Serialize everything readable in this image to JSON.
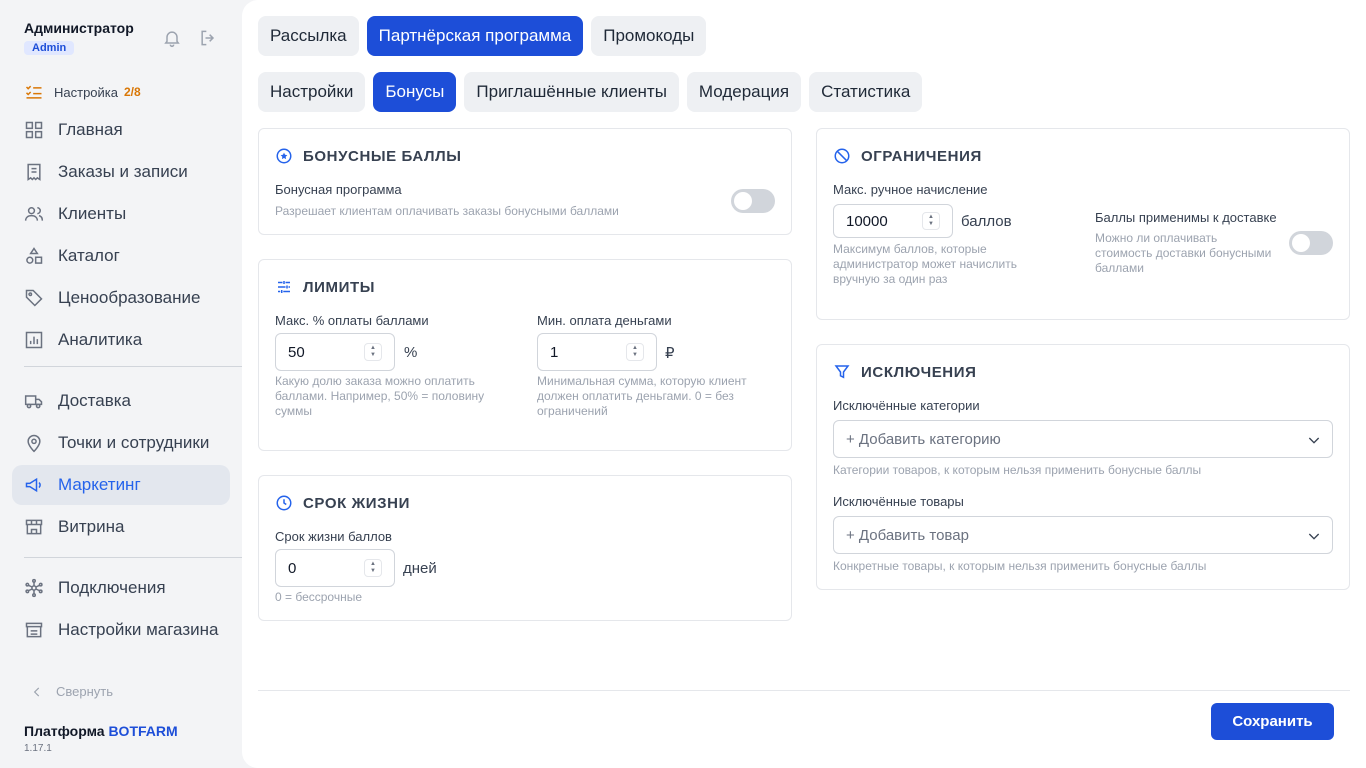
{
  "user": {
    "name": "Администратор",
    "role": "Admin"
  },
  "setup": {
    "label": "Настройка",
    "progress": "2/8"
  },
  "nav": {
    "group1": [
      {
        "label": "Главная",
        "icon": "grid-icon"
      },
      {
        "label": "Заказы и записи",
        "icon": "receipt-icon"
      },
      {
        "label": "Клиенты",
        "icon": "users-icon"
      },
      {
        "label": "Каталог",
        "icon": "shapes-icon"
      },
      {
        "label": "Ценообразование",
        "icon": "tag-icon"
      },
      {
        "label": "Аналитика",
        "icon": "chart-icon"
      }
    ],
    "group2": [
      {
        "label": "Доставка",
        "icon": "truck-icon"
      },
      {
        "label": "Точки и сотрудники",
        "icon": "map-pin-icon"
      },
      {
        "label": "Маркетинг",
        "icon": "megaphone-icon"
      },
      {
        "label": "Витрина",
        "icon": "store-icon"
      }
    ],
    "group3": [
      {
        "label": "Подключения",
        "icon": "network-icon"
      },
      {
        "label": "Настройки магазина",
        "icon": "shop-settings-icon"
      }
    ],
    "active": "Маркетинг"
  },
  "collapse_label": "Свернуть",
  "platform": {
    "prefix": "Платформа",
    "brand": "BOTFARM",
    "version": "1.17.1"
  },
  "tabs_top": [
    "Рассылка",
    "Партнёрская программа",
    "Промокоды"
  ],
  "tabs_top_active": "Партнёрская программа",
  "tabs_sub": [
    "Настройки",
    "Бонусы",
    "Приглашённые клиенты",
    "Модерация",
    "Статистика"
  ],
  "tabs_sub_active": "Бонусы",
  "bonus": {
    "title": "БОНУСНЫЕ БАЛЛЫ",
    "program_label": "Бонусная программа",
    "program_hint": "Разрешает клиентам оплачивать заказы бонусными баллами",
    "program_enabled": false
  },
  "limits": {
    "title": "ЛИМИТЫ",
    "max_pct_label": "Макс. % оплаты баллами",
    "max_pct_value": "50",
    "max_pct_unit": "%",
    "max_pct_hint": "Какую долю заказа можно оплатить баллами. Например, 50% = половину суммы",
    "min_money_label": "Мин. оплата деньгами",
    "min_money_value": "1",
    "min_money_unit": "₽",
    "min_money_hint": "Минимальная сумма, которую клиент должен оплатить деньгами. 0 = без ограничений"
  },
  "lifetime": {
    "title": "СРОК ЖИЗНИ",
    "label": "Срок жизни баллов",
    "value": "0",
    "unit": "дней",
    "hint": "0 = бессрочные"
  },
  "restrictions": {
    "title": "ОГРАНИЧЕНИЯ",
    "manual_label": "Макс. ручное начисление",
    "manual_value": "10000",
    "manual_unit": "баллов",
    "manual_hint": "Максимум баллов, которые администратор может начислить вручную за один раз",
    "delivery_label": "Баллы применимы к доставке",
    "delivery_hint": "Можно ли оплачивать стоимость доставки бонусными баллами",
    "delivery_enabled": false
  },
  "exclusions": {
    "title": "ИСКЛЮЧЕНИЯ",
    "categories_label": "Исключённые категории",
    "categories_placeholder": "+ Добавить категорию",
    "categories_hint": "Категории товаров, к которым нельзя применить бонусные баллы",
    "products_label": "Исключённые товары",
    "products_placeholder": "+ Добавить товар",
    "products_hint": "Конкретные товары, к которым нельзя применить бонусные баллы"
  },
  "save_label": "Сохранить",
  "colors": {
    "accent": "#1d4ed8",
    "active_nav_bg": "#e3e7ee",
    "progress": "#d97706"
  }
}
